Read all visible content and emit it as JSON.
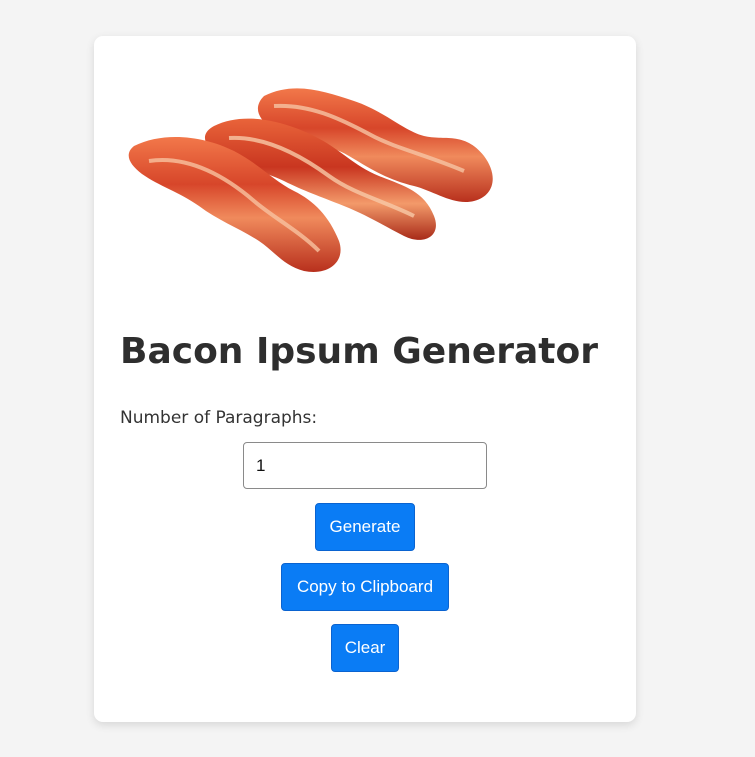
{
  "page": {
    "title": "Bacon Ipsum Generator",
    "image_alt": "bacon strips"
  },
  "form": {
    "paragraphs_label": "Number of Paragraphs:",
    "paragraphs_value": "1"
  },
  "buttons": {
    "generate": "Generate",
    "copy": "Copy to Clipboard",
    "clear": "Clear"
  },
  "colors": {
    "page_background": "#f4f4f4",
    "card_background": "#ffffff",
    "button_blue": "#0a7cf5",
    "title_text": "#2e2e2e"
  }
}
